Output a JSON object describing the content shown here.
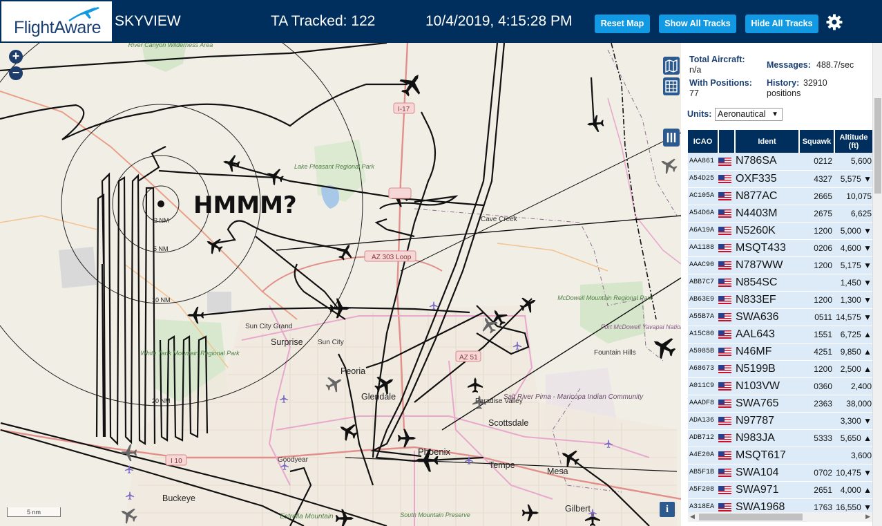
{
  "header": {
    "logo_text": "FlightAware",
    "app_title": "SKYVIEW",
    "tracked": "TA Tracked: 122",
    "datetime": "10/4/2019, 4:15:28 PM",
    "buttons": {
      "reset_map": "Reset Map",
      "show_all_tracks": "Show All Tracks",
      "hide_all_tracks": "Hide All Tracks"
    },
    "gear_icon": "gear-icon"
  },
  "map": {
    "zoom_in": "+",
    "zoom_out": "−",
    "overlay_text": "HMMM?",
    "scale": "5 nm",
    "info": "i",
    "range_labels": [
      "2 NM",
      "5 NM",
      "10 NM",
      "20 NM"
    ],
    "places": {
      "lake_pleasant": "Lake Pleasant Regional Park",
      "river_canyon": "River Canyon Wilderness Area",
      "i17": "I-17",
      "cave_creek": "Cave Creek",
      "az303": "AZ 303 Loop",
      "mcdowell": "McDowell Mountain Regional Park",
      "fort_mcdowell": "Fort McDowell Yavapai Nation",
      "fountain_hills": "Fountain Hills",
      "sun_city_grand": "Sun City Grand",
      "surprise": "Surprise",
      "sun_city": "Sun City",
      "white_tank": "White Tank Mountain Regional Park",
      "peoria": "Peoria",
      "glendale": "Glendale",
      "paradise_valley": "Paradise Valley",
      "scottsdale": "Scottsdale",
      "salt_river": "Salt River Pima - Maricopa Indian Community",
      "az51": "AZ 51",
      "goodyear": "Goodyear",
      "i10": "I 10",
      "phoenix": "Phoenix",
      "tempe": "Tempe",
      "mesa": "Mesa",
      "buckeye": "Buckeye",
      "estrella": "Estrella Mountain",
      "south_mountain": "South Mountain Preserve",
      "gilbert": "Gilbert"
    },
    "controls": [
      "map-layers-icon",
      "grid-icon",
      "columns-icon"
    ]
  },
  "panel": {
    "stats": {
      "total_aircraft_label": "Total Aircraft:",
      "total_aircraft_value": "n/a",
      "with_positions_label": "With Positions:",
      "with_positions_value": "77",
      "messages_label": "Messages:",
      "messages_value": "488.7/sec",
      "history_label": "History:",
      "history_value": "32910",
      "history_unit": "positions"
    },
    "units_label": "Units:",
    "units_value": "Aeronautical",
    "columns": [
      "ICAO",
      "",
      "Ident",
      "Squawk",
      "Altitude (ft)"
    ],
    "rows": [
      {
        "icao": "AAA861",
        "ident": "N786SA",
        "squawk": "0212",
        "alt": "5,600",
        "trend": ""
      },
      {
        "icao": "A54D25",
        "ident": "OXF335",
        "squawk": "4327",
        "alt": "5,575",
        "trend": "▼"
      },
      {
        "icao": "AC105A",
        "ident": "N877AC",
        "squawk": "2665",
        "alt": "10,075",
        "trend": ""
      },
      {
        "icao": "A54D6A",
        "ident": "N4403M",
        "squawk": "2675",
        "alt": "6,625",
        "trend": ""
      },
      {
        "icao": "A6A19A",
        "ident": "N5260K",
        "squawk": "1200",
        "alt": "5,000",
        "trend": "▼"
      },
      {
        "icao": "AA1188",
        "ident": "MSQT433",
        "squawk": "0206",
        "alt": "4,600",
        "trend": "▼"
      },
      {
        "icao": "AAAC90",
        "ident": "N787WW",
        "squawk": "1200",
        "alt": "5,175",
        "trend": "▼"
      },
      {
        "icao": "ABB7C7",
        "ident": "N854SC",
        "squawk": "",
        "alt": "1,450",
        "trend": "▼"
      },
      {
        "icao": "AB63E9",
        "ident": "N833EF",
        "squawk": "1200",
        "alt": "1,300",
        "trend": "▼"
      },
      {
        "icao": "A55B7A",
        "ident": "SWA636",
        "squawk": "0511",
        "alt": "14,575",
        "trend": "▼"
      },
      {
        "icao": "A15C80",
        "ident": "AAL643",
        "squawk": "1551",
        "alt": "6,725",
        "trend": "▲"
      },
      {
        "icao": "A5985B",
        "ident": "N46MF",
        "squawk": "4251",
        "alt": "9,850",
        "trend": "▲"
      },
      {
        "icao": "A68673",
        "ident": "N5199B",
        "squawk": "1200",
        "alt": "2,500",
        "trend": "▲"
      },
      {
        "icao": "A011C9",
        "ident": "N103VW",
        "squawk": "0360",
        "alt": "2,400",
        "trend": ""
      },
      {
        "icao": "AAADF8",
        "ident": "SWA765",
        "squawk": "2363",
        "alt": "38,000",
        "trend": ""
      },
      {
        "icao": "ADA136",
        "ident": "N97787",
        "squawk": "",
        "alt": "3,300",
        "trend": "▼"
      },
      {
        "icao": "ADB712",
        "ident": "N983JA",
        "squawk": "5333",
        "alt": "5,650",
        "trend": "▲"
      },
      {
        "icao": "A4E20A",
        "ident": "MSQT617",
        "squawk": "",
        "alt": "3,600",
        "trend": ""
      },
      {
        "icao": "AB5F1B",
        "ident": "SWA104",
        "squawk": "0702",
        "alt": "10,475",
        "trend": "▼"
      },
      {
        "icao": "A5F208",
        "ident": "SWA971",
        "squawk": "2651",
        "alt": "4,000",
        "trend": "▲"
      },
      {
        "icao": "A318EA",
        "ident": "SWA1968",
        "squawk": "1763",
        "alt": "16,550",
        "trend": "▼"
      }
    ]
  },
  "colors": {
    "header_bg": "#002f5d",
    "button": "#119ae3",
    "row_bg": "#dcebf7",
    "label": "#1c3f73"
  }
}
